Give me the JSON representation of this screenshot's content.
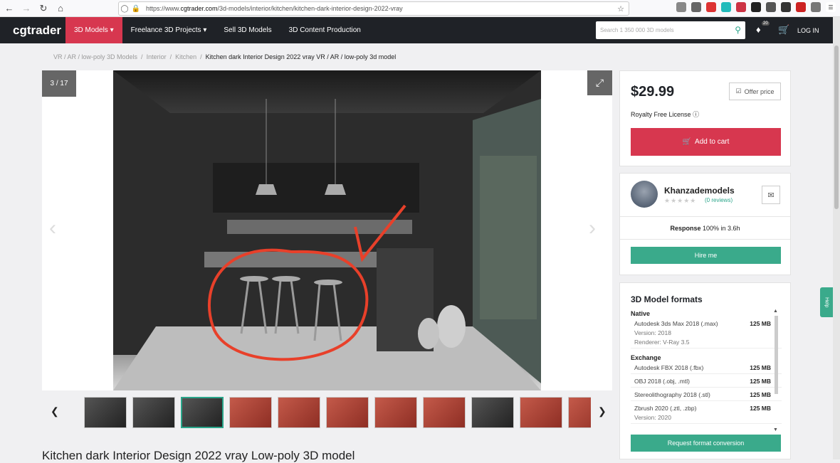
{
  "browser": {
    "url_prefix": "https://www.",
    "url_host": "cgtrader.com",
    "url_path": "/3d-models/interior/kitchen/kitchen-dark-interior-design-2022-vray"
  },
  "header": {
    "logo": "cgtrader",
    "nav": [
      "3D Models",
      "Freelance 3D Projects",
      "Sell 3D Models",
      "3D Content Production"
    ],
    "search_placeholder": "Search 1 350 000 3D models",
    "cart_count": "20",
    "login": "LOG IN"
  },
  "breadcrumb": {
    "items": [
      "VR / AR / low-poly 3D Models",
      "Interior",
      "Kitchen"
    ],
    "current": "Kitchen dark Interior Design 2022 vray VR / AR / low-poly 3d model"
  },
  "gallery": {
    "counter": "3 / 17",
    "thumbnails": [
      "dark",
      "dark",
      "dark",
      "red",
      "red",
      "red",
      "red",
      "red",
      "dark",
      "red",
      "red"
    ],
    "selected_thumbnail": 2
  },
  "product": {
    "price": "$29.99",
    "offer_label": "Offer price",
    "license": "Royalty Free License",
    "add_to_cart": "Add to cart"
  },
  "author": {
    "name": "Khanzademodels",
    "reviews": "(0 reviews)",
    "response_label": "Response",
    "response_value": "100% in 3.6h",
    "hire": "Hire me"
  },
  "formats": {
    "title": "3D Model formats",
    "native_label": "Native",
    "native": [
      {
        "name": "Autodesk 3ds Max 2018 (.max)",
        "size": "125 MB",
        "version": "Version: 2018",
        "renderer": "Renderer: V-Ray 3.5"
      }
    ],
    "exchange_label": "Exchange",
    "exchange": [
      {
        "name": "Autodesk FBX 2018 (.fbx)",
        "size": "125 MB"
      },
      {
        "name": "OBJ 2018 (.obj, .mtl)",
        "size": "125 MB"
      },
      {
        "name": "Stereolithography 2018 (.stl)",
        "size": "125 MB"
      },
      {
        "name": "Zbrush 2020 (.ztl, .zbp)",
        "size": "125 MB",
        "version": "Version: 2020"
      }
    ],
    "request": "Request format conversion"
  },
  "page_heading": "Kitchen dark Interior Design 2022 vray Low-poly 3D model",
  "help": "Help"
}
